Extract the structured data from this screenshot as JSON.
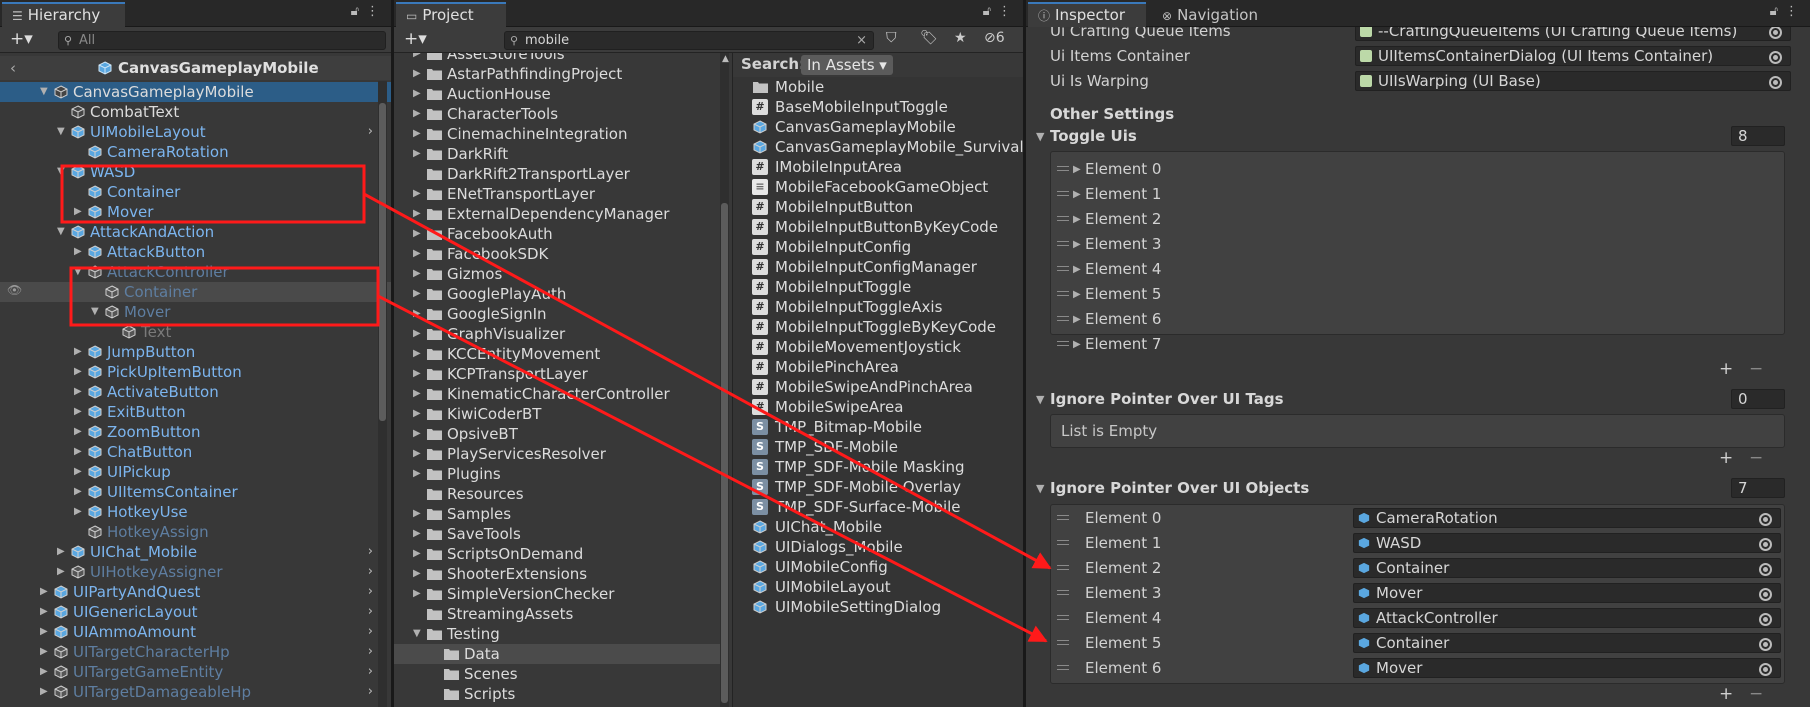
{
  "hierarchy": {
    "tab": "Hierarchy",
    "search_placeholder": "All",
    "scene": "CanvasGameplayMobile",
    "rows": [
      {
        "label": "CanvasGameplayMobile",
        "depth": 0,
        "tri": "down",
        "style": "white",
        "sel": true
      },
      {
        "label": "CombatText",
        "depth": 1,
        "tri": "",
        "style": "white"
      },
      {
        "label": "UIMobileLayout",
        "depth": 1,
        "tri": "down",
        "style": "blue",
        "chev": true
      },
      {
        "label": "CameraRotation",
        "depth": 2,
        "tri": "",
        "style": "blue"
      },
      {
        "label": "WASD",
        "depth": 1,
        "tri": "down",
        "style": "blue"
      },
      {
        "label": "Container",
        "depth": 2,
        "tri": "",
        "style": "blue"
      },
      {
        "label": "Mover",
        "depth": 2,
        "tri": "right",
        "style": "blue"
      },
      {
        "label": "AttackAndAction",
        "depth": 1,
        "tri": "down",
        "style": "blue"
      },
      {
        "label": "AttackButton",
        "depth": 2,
        "tri": "right",
        "style": "blue"
      },
      {
        "label": "AttackController",
        "depth": 2,
        "tri": "down",
        "style": "dim"
      },
      {
        "label": "Container",
        "depth": 3,
        "tri": "",
        "style": "dim",
        "hover": true
      },
      {
        "label": "Mover",
        "depth": 3,
        "tri": "down",
        "style": "dim"
      },
      {
        "label": "Text",
        "depth": 4,
        "tri": "",
        "style": "dimw"
      },
      {
        "label": "JumpButton",
        "depth": 2,
        "tri": "right",
        "style": "blue"
      },
      {
        "label": "PickUpItemButton",
        "depth": 2,
        "tri": "right",
        "style": "blue"
      },
      {
        "label": "ActivateButton",
        "depth": 2,
        "tri": "right",
        "style": "blue"
      },
      {
        "label": "ExitButton",
        "depth": 2,
        "tri": "right",
        "style": "blue"
      },
      {
        "label": "ZoomButton",
        "depth": 2,
        "tri": "right",
        "style": "blue"
      },
      {
        "label": "ChatButton",
        "depth": 2,
        "tri": "right",
        "style": "blue"
      },
      {
        "label": "UIPickup",
        "depth": 2,
        "tri": "right",
        "style": "blue"
      },
      {
        "label": "UIItemsContainer",
        "depth": 2,
        "tri": "right",
        "style": "blue"
      },
      {
        "label": "HotkeyUse",
        "depth": 2,
        "tri": "right",
        "style": "blue"
      },
      {
        "label": "HotkeyAssign",
        "depth": 2,
        "tri": "",
        "style": "dim"
      },
      {
        "label": "UIChat_Mobile",
        "depth": 1,
        "tri": "right",
        "style": "blue",
        "chev": true
      },
      {
        "label": "UIHotkeyAssigner",
        "depth": 1,
        "tri": "right",
        "style": "dim",
        "chev": true
      },
      {
        "label": "UIPartyAndQuest",
        "depth": 0,
        "tri": "right",
        "style": "blue",
        "chev": true
      },
      {
        "label": "UIGenericLayout",
        "depth": 0,
        "tri": "right",
        "style": "blue",
        "chev": true
      },
      {
        "label": "UIAmmoAmount",
        "depth": 0,
        "tri": "right",
        "style": "blue",
        "chev": true
      },
      {
        "label": "UITargetCharacterHp",
        "depth": 0,
        "tri": "right",
        "style": "dim",
        "chev": true
      },
      {
        "label": "UITargetGameEntity",
        "depth": 0,
        "tri": "right",
        "style": "dim",
        "chev": true
      },
      {
        "label": "UITargetDamageableHp",
        "depth": 0,
        "tri": "right",
        "style": "dim",
        "chev": true
      }
    ]
  },
  "project": {
    "tab": "Project",
    "search_value": "mobile",
    "hidden_count": "6",
    "search_label": "Search:",
    "search_scope": "In Assets",
    "folders": [
      {
        "label": "AssetStoreTools",
        "tri": "right",
        "depth": 0
      },
      {
        "label": "AstarPathfindingProject",
        "tri": "right",
        "depth": 0
      },
      {
        "label": "AuctionHouse",
        "tri": "right",
        "depth": 0
      },
      {
        "label": "CharacterTools",
        "tri": "right",
        "depth": 0
      },
      {
        "label": "CinemachineIntegration",
        "tri": "right",
        "depth": 0
      },
      {
        "label": "DarkRift",
        "tri": "right",
        "depth": 0
      },
      {
        "label": "DarkRift2TransportLayer",
        "tri": "",
        "depth": 0
      },
      {
        "label": "ENetTransportLayer",
        "tri": "right",
        "depth": 0
      },
      {
        "label": "ExternalDependencyManager",
        "tri": "right",
        "depth": 0
      },
      {
        "label": "FacebookAuth",
        "tri": "right",
        "depth": 0
      },
      {
        "label": "FacebookSDK",
        "tri": "right",
        "depth": 0
      },
      {
        "label": "Gizmos",
        "tri": "right",
        "depth": 0
      },
      {
        "label": "GooglePlayAuth",
        "tri": "right",
        "depth": 0
      },
      {
        "label": "GoogleSignIn",
        "tri": "right",
        "depth": 0
      },
      {
        "label": "GraphVisualizer",
        "tri": "right",
        "depth": 0
      },
      {
        "label": "KCCEntityMovement",
        "tri": "right",
        "depth": 0
      },
      {
        "label": "KCPTransportLayer",
        "tri": "right",
        "depth": 0
      },
      {
        "label": "KinematicCharacterController",
        "tri": "right",
        "depth": 0
      },
      {
        "label": "KiwiCoderBT",
        "tri": "right",
        "depth": 0
      },
      {
        "label": "OpsiveBT",
        "tri": "right",
        "depth": 0
      },
      {
        "label": "PlayServicesResolver",
        "tri": "right",
        "depth": 0
      },
      {
        "label": "Plugins",
        "tri": "right",
        "depth": 0
      },
      {
        "label": "Resources",
        "tri": "",
        "depth": 0
      },
      {
        "label": "Samples",
        "tri": "right",
        "depth": 0
      },
      {
        "label": "SaveTools",
        "tri": "right",
        "depth": 0
      },
      {
        "label": "ScriptsOnDemand",
        "tri": "right",
        "depth": 0
      },
      {
        "label": "ShooterExtensions",
        "tri": "right",
        "depth": 0
      },
      {
        "label": "SimpleVersionChecker",
        "tri": "right",
        "depth": 0
      },
      {
        "label": "StreamingAssets",
        "tri": "",
        "depth": 0
      },
      {
        "label": "Testing",
        "tri": "down",
        "depth": 0,
        "open": true
      },
      {
        "label": "Data",
        "tri": "",
        "depth": 1,
        "sel": true
      },
      {
        "label": "Scenes",
        "tri": "",
        "depth": 1
      },
      {
        "label": "Scripts",
        "tri": "",
        "depth": 1
      }
    ],
    "results": [
      {
        "label": "Mobile",
        "icon": "folder"
      },
      {
        "label": "BaseMobileInputToggle",
        "icon": "hash"
      },
      {
        "label": "CanvasGameplayMobile",
        "icon": "cube"
      },
      {
        "label": "CanvasGameplayMobile_Survival",
        "icon": "cube"
      },
      {
        "label": "IMobileInputArea",
        "icon": "hash"
      },
      {
        "label": "MobileFacebookGameObject",
        "icon": "doc"
      },
      {
        "label": "MobileInputButton",
        "icon": "hash"
      },
      {
        "label": "MobileInputButtonByKeyCode",
        "icon": "hash"
      },
      {
        "label": "MobileInputConfig",
        "icon": "hash"
      },
      {
        "label": "MobileInputConfigManager",
        "icon": "hash"
      },
      {
        "label": "MobileInputToggle",
        "icon": "hash"
      },
      {
        "label": "MobileInputToggleAxis",
        "icon": "hash"
      },
      {
        "label": "MobileInputToggleByKeyCode",
        "icon": "hash"
      },
      {
        "label": "MobileMovementJoystick",
        "icon": "hash"
      },
      {
        "label": "MobilePinchArea",
        "icon": "hash"
      },
      {
        "label": "MobileSwipeAndPinchArea",
        "icon": "hash"
      },
      {
        "label": "MobileSwipeArea",
        "icon": "hash"
      },
      {
        "label": "TMP_Bitmap-Mobile",
        "icon": "s"
      },
      {
        "label": "TMP_SDF-Mobile",
        "icon": "s"
      },
      {
        "label": "TMP_SDF-Mobile Masking",
        "icon": "s"
      },
      {
        "label": "TMP_SDF-Mobile Overlay",
        "icon": "s"
      },
      {
        "label": "TMP_SDF-Surface-Mobile",
        "icon": "s"
      },
      {
        "label": "UIChat_Mobile",
        "icon": "cube"
      },
      {
        "label": "UIDialogs_Mobile",
        "icon": "cube"
      },
      {
        "label": "UIMobileConfig",
        "icon": "cube"
      },
      {
        "label": "UIMobileLayout",
        "icon": "cube"
      },
      {
        "label": "UIMobileSettingDialog",
        "icon": "cube"
      }
    ]
  },
  "inspector": {
    "tab": "Inspector",
    "tab2": "Navigation",
    "top_fields": [
      {
        "label": "Ui Crafting Queue Items",
        "value": "--CraftingQueueItems (UI Crafting Queue Items)"
      },
      {
        "label": "Ui Items Container",
        "value": "UIItemsContainerDialog (UI Items Container)"
      },
      {
        "label": "Ui Is Warping",
        "value": "UIIsWarping (UI Base)"
      }
    ],
    "other_settings": "Other Settings",
    "toggle_uis": {
      "label": "Toggle Uis",
      "count": "8",
      "elements": [
        "Element 0",
        "Element 1",
        "Element 2",
        "Element 3",
        "Element 4",
        "Element 5",
        "Element 6",
        "Element 7"
      ]
    },
    "ignore_tags": {
      "label": "Ignore Pointer Over UI Tags",
      "count": "0",
      "empty": "List is Empty"
    },
    "ignore_objects": {
      "label": "Ignore Pointer Over UI Objects",
      "count": "7",
      "elements": [
        {
          "label": "Element 0",
          "value": "CameraRotation"
        },
        {
          "label": "Element 1",
          "value": "WASD"
        },
        {
          "label": "Element 2",
          "value": "Container"
        },
        {
          "label": "Element 3",
          "value": "Mover"
        },
        {
          "label": "Element 4",
          "value": "AttackController"
        },
        {
          "label": "Element 5",
          "value": "Container"
        },
        {
          "label": "Element 6",
          "value": "Mover"
        }
      ]
    },
    "plus": "+",
    "minus": "−"
  },
  "colors": {
    "accent": "#3a79bb",
    "selection": "#2c5d87",
    "annotation": "#ff1a1a",
    "prefab_blue": "#7cb5ef"
  }
}
